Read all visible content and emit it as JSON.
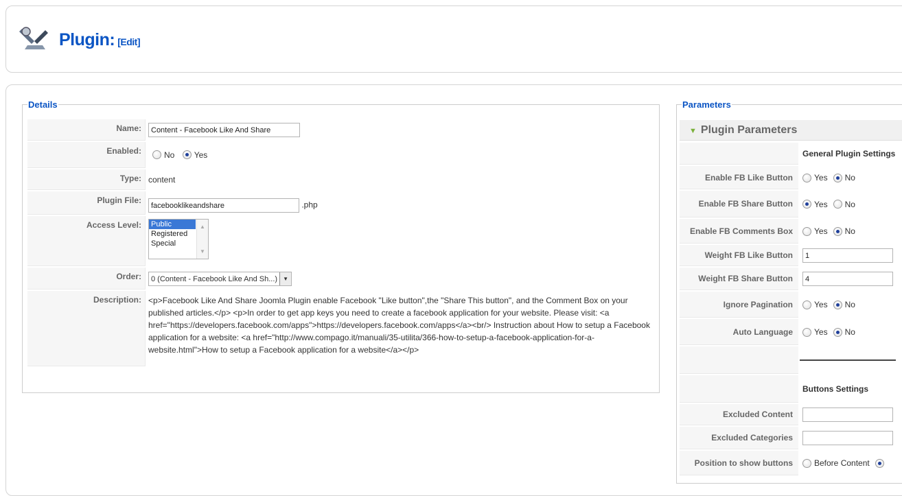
{
  "header": {
    "title": "Plugin:",
    "edit_label": "[Edit]"
  },
  "details": {
    "legend": "Details",
    "name_label": "Name:",
    "name_value": "Content - Facebook Like And Share",
    "enabled_label": "Enabled:",
    "enabled_no": "No",
    "enabled_yes": "Yes",
    "type_label": "Type:",
    "type_value": "content",
    "plugin_file_label": "Plugin File:",
    "plugin_file_value": "facebooklikeandshare",
    "plugin_file_ext": ".php",
    "access_label": "Access Level:",
    "access_options": [
      "Public",
      "Registered",
      "Special"
    ],
    "order_label": "Order:",
    "order_value": "0 (Content - Facebook Like And Sh...)",
    "description_label": "Description:",
    "description_value": "<p>Facebook Like And Share Joomla Plugin enable Facebook \"Like button\",the \"Share This button\", and the Comment Box on your published articles.</p> <p>In order to get app keys you need to create a facebook application for your website. Please visit: <a href=\"https://developers.facebook.com/apps\">https://developers.facebook.com/apps</a><br/> Instruction about How to setup a Facebook application for a website: <a href=\"http://www.compago.it/manuali/35-utilita/366-how-to-setup-a-facebook-application-for-a-website.html\">How to setup a Facebook application for a website</a></p>"
  },
  "params": {
    "legend": "Parameters",
    "toggle_label": "Plugin Parameters",
    "general_header": "General Plugin Settings",
    "enable_like_label": "Enable FB Like Button",
    "enable_share_label": "Enable FB Share Button",
    "enable_comments_label": "Enable FB Comments Box",
    "weight_like_label": "Weight FB Like Button",
    "weight_like_value": "1",
    "weight_share_label": "Weight FB Share Button",
    "weight_share_value": "4",
    "ignore_pagination_label": "Ignore Pagination",
    "auto_language_label": "Auto Language",
    "yes": "Yes",
    "no": "No",
    "buttons_header": "Buttons Settings",
    "excluded_content_label": "Excluded Content",
    "excluded_categories_label": "Excluded Categories",
    "position_label": "Position to show buttons",
    "position_before": "Before Content"
  }
}
